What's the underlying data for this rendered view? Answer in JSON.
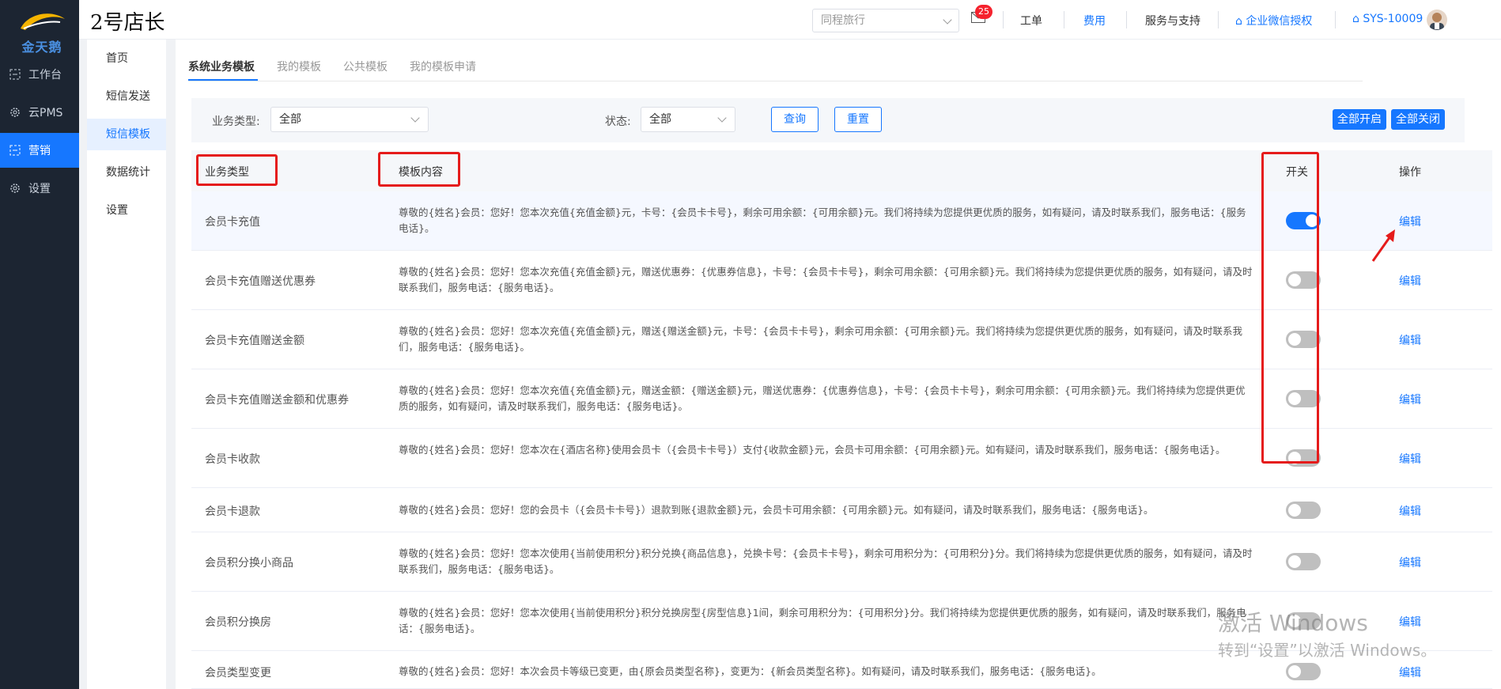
{
  "brand": {
    "logo_text": "金天鹅",
    "title": "2号店长"
  },
  "rail": {
    "items": [
      {
        "label": "工作台",
        "icon": "workbench-icon"
      },
      {
        "label": "云PMS",
        "icon": "gear-icon"
      },
      {
        "label": "营销",
        "icon": "marketing-icon",
        "active": true
      },
      {
        "label": "设置",
        "icon": "gear-icon"
      }
    ]
  },
  "header": {
    "hotel_select": {
      "placeholder": "同程旅行"
    },
    "mail_badge": "25",
    "nav": {
      "ticket": "工单",
      "fee": "费用",
      "service": "服务与支持",
      "wecom": "企业微信授权",
      "user": "SYS-10009"
    }
  },
  "submenu": {
    "items": [
      {
        "label": "首页"
      },
      {
        "label": "短信发送"
      },
      {
        "label": "短信模板",
        "active": true
      },
      {
        "label": "数据统计"
      },
      {
        "label": "设置"
      }
    ]
  },
  "tabs": [
    {
      "label": "系统业务模板",
      "active": true
    },
    {
      "label": "我的模板"
    },
    {
      "label": "公共模板"
    },
    {
      "label": "我的模板申请"
    }
  ],
  "filter": {
    "type_label": "业务类型:",
    "type_value": "全部",
    "status_label": "状态:",
    "status_value": "全部",
    "query_button": "查询",
    "reset_button": "重置",
    "enable_all_button": "全部开启",
    "disable_all_button": "全部关闭"
  },
  "table": {
    "headers": {
      "type": "业务类型",
      "content": "模板内容",
      "switch": "开关",
      "action": "操作"
    },
    "edit_label": "编辑",
    "rows": [
      {
        "type": "会员卡充值",
        "content": "尊敬的{姓名}会员：您好！您本次充值{充值金额}元，卡号：{会员卡卡号}，剩余可用余额：{可用余额}元。我们将持续为您提供更优质的服务，如有疑问，请及时联系我们，服务电话：{服务电话}。",
        "enabled": true
      },
      {
        "type": "会员卡充值赠送优惠券",
        "content": "尊敬的{姓名}会员：您好！您本次充值{充值金额}元，赠送优惠券：{优惠券信息}，卡号：{会员卡卡号}，剩余可用余额：{可用余额}元。我们将持续为您提供更优质的服务，如有疑问，请及时联系我们，服务电话：{服务电话}。",
        "enabled": false
      },
      {
        "type": "会员卡充值赠送金额",
        "content": "尊敬的{姓名}会员：您好！您本次充值{充值金额}元，赠送{赠送金额}元，卡号：{会员卡卡号}，剩余可用余额：{可用余额}元。我们将持续为您提供更优质的服务，如有疑问，请及时联系我们，服务电话：{服务电话}。",
        "enabled": false
      },
      {
        "type": "会员卡充值赠送金额和优惠券",
        "content": "尊敬的{姓名}会员：您好！您本次充值{充值金额}元，赠送金额：{赠送金额}元，赠送优惠券：{优惠券信息}，卡号：{会员卡卡号}，剩余可用余额：{可用余额}元。我们将持续为您提供更优质的服务，如有疑问，请及时联系我们，服务电话：{服务电话}。",
        "enabled": false
      },
      {
        "type": "会员卡收款",
        "content": "尊敬的{姓名}会员：您好！您本次在{酒店名称}使用会员卡（{会员卡卡号}）支付{收款金额}元，会员卡可用余额：{可用余额}元。如有疑问，请及时联系我们，服务电话：{服务电话}。",
        "enabled": false
      },
      {
        "type": "会员卡退款",
        "content": "尊敬的{姓名}会员：您好！您的会员卡（{会员卡卡号}）退款到账{退款金额}元，会员卡可用余额：{可用余额}元。如有疑问，请及时联系我们，服务电话：{服务电话}。",
        "enabled": false
      },
      {
        "type": "会员积分换小商品",
        "content": "尊敬的{姓名}会员：您好！您本次使用{当前使用积分}积分兑换{商品信息}，兑换卡号：{会员卡卡号}，剩余可用积分为：{可用积分}分。我们将持续为您提供更优质的服务，如有疑问，请及时联系我们，服务电话：{服务电话}。",
        "enabled": false
      },
      {
        "type": "会员积分换房",
        "content": "尊敬的{姓名}会员：您好！您本次使用{当前使用积分}积分兑换房型{房型信息}1间，剩余可用积分为：{可用积分}分。我们将持续为您提供更优质的服务，如有疑问，请及时联系我们，服务电话：{服务电话}。",
        "enabled": false
      },
      {
        "type": "会员类型变更",
        "content": "尊敬的{姓名}会员：您好！本次会员卡等级已变更，由{原会员类型名称}，变更为：{新会员类型名称}。如有疑问，请及时联系我们，服务电话：{服务电话}。",
        "enabled": false
      }
    ]
  },
  "watermark": {
    "line1": "激活 Windows",
    "line2": "转到“设置”以激活 Windows。"
  },
  "colors": {
    "primary": "#1677ff",
    "rail_bg": "#1c2532",
    "annotation_red": "#e51b1b"
  }
}
